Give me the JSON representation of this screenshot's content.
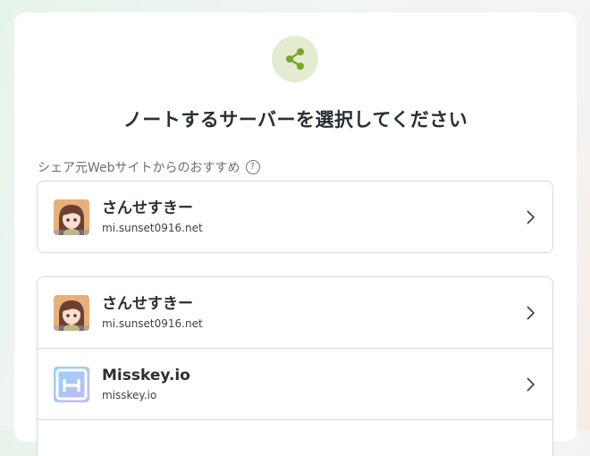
{
  "page": {
    "title": "ノートするサーバーを選択してください",
    "section_label": "シェア元Webサイトからのおすすめ",
    "help_icon_glyph": "?"
  },
  "icons": {
    "share": "share-icon",
    "help": "help-circle-icon",
    "chevron": "chevron-right-icon"
  },
  "colors": {
    "accent": "#86b300",
    "share_bg": "#e3ecd0"
  },
  "recommended": [
    {
      "name": "さんせすきー",
      "host": "mi.sunset0916.net",
      "avatar": "sunset-avatar"
    }
  ],
  "servers": [
    {
      "name": "さんせすきー",
      "host": "mi.sunset0916.net",
      "avatar": "sunset-avatar"
    },
    {
      "name": "Misskey.io",
      "host": "misskey.io",
      "avatar": "misskey-io-logo"
    }
  ]
}
